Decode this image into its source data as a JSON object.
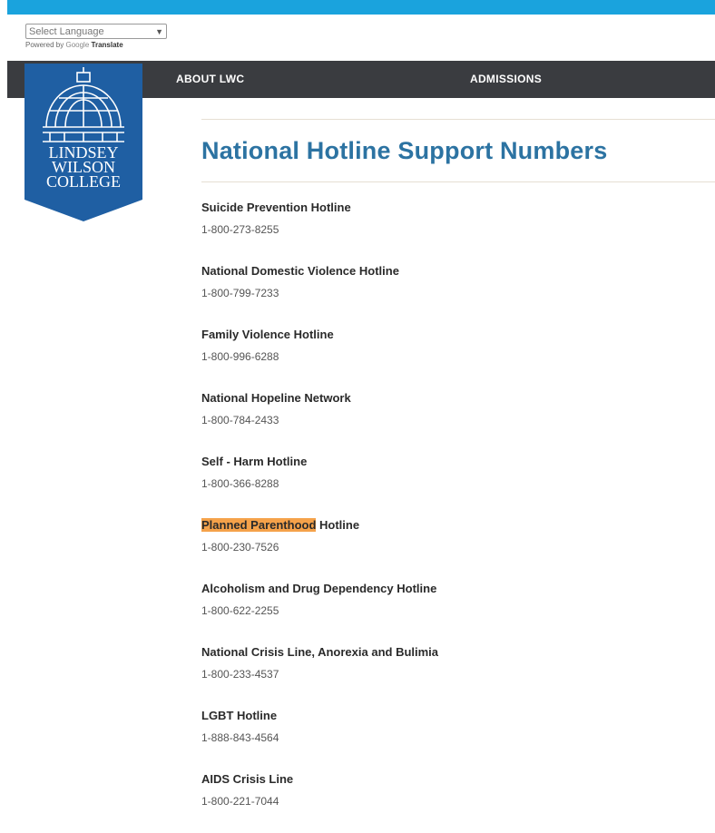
{
  "translate": {
    "select_label": "Select Language",
    "powered_by": "Powered by",
    "google": "Google",
    "translate": "Translate"
  },
  "logo": {
    "line1": "LINDSEY",
    "line2": "WILSON",
    "line3": "COLLEGE"
  },
  "nav": {
    "items": [
      {
        "label": "ABOUT LWC"
      },
      {
        "label": "ADMISSIONS"
      }
    ]
  },
  "page": {
    "title": "National Hotline Support Numbers"
  },
  "hotlines": [
    {
      "name": "Suicide Prevention Hotline",
      "phone": "1-800-273-8255"
    },
    {
      "name": "National Domestic Violence Hotline",
      "phone": "1-800-799-7233"
    },
    {
      "name": "Family Violence Hotline",
      "phone": "1-800-996-6288"
    },
    {
      "name": "National Hopeline Network",
      "phone": "1-800-784-2433"
    },
    {
      "name": "Self - Harm Hotline",
      "phone": "1-800-366-8288"
    },
    {
      "name_highlight": "Planned Parenthood",
      "name_rest": " Hotline",
      "phone": "1-800-230-7526"
    },
    {
      "name": "Alcoholism and Drug Dependency Hotline",
      "phone": "1-800-622-2255"
    },
    {
      "name": "National Crisis Line, Anorexia and Bulimia",
      "phone": "1-800-233-4537"
    },
    {
      "name": "LGBT Hotline",
      "phone": "1-888-843-4564"
    },
    {
      "name": "AIDS Crisis Line",
      "phone": "1-800-221-7044"
    }
  ],
  "colors": {
    "top_bar": "#1aa3dd",
    "nav_bg": "#3a3c40",
    "logo_blue": "#1f5fa3",
    "title_blue": "#2c73a2",
    "highlight": "#f5a24a"
  }
}
